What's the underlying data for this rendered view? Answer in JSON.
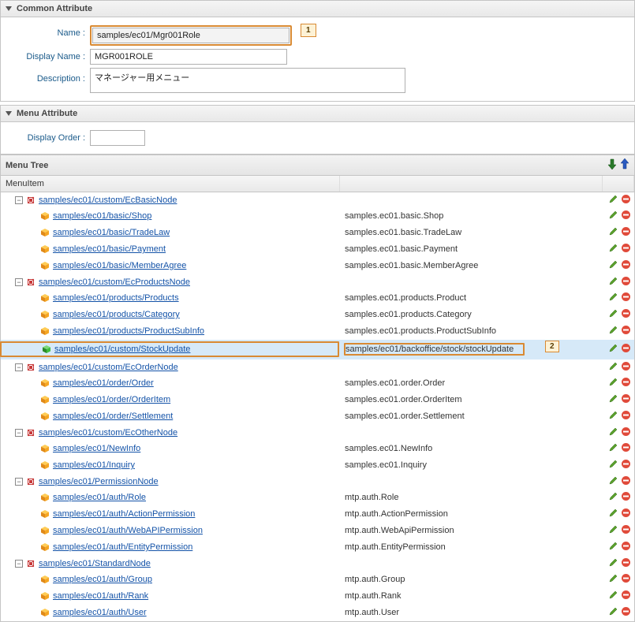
{
  "commonAttr": {
    "header": "Common Attribute",
    "name_label": "Name :",
    "name_value": "samples/ec01/Mgr001Role",
    "displayname_label": "Display Name :",
    "displayname_value": "MGR001ROLE",
    "description_label": "Description :",
    "description_value": "マネージャー用メニュー",
    "callout1": "1"
  },
  "menuAttr": {
    "header": "Menu Attribute",
    "displayorder_label": "Display Order :",
    "displayorder_value": ""
  },
  "menuTree": {
    "header": "Menu Tree",
    "col_menuitem": "MenuItem",
    "nodes": [
      {
        "type": "folder",
        "level": 0,
        "label": "samples/ec01/custom/EcBasicNode"
      },
      {
        "type": "item",
        "level": 1,
        "label": "samples/ec01/basic/Shop",
        "path": "samples.ec01.basic.Shop"
      },
      {
        "type": "item",
        "level": 1,
        "label": "samples/ec01/basic/TradeLaw",
        "path": "samples.ec01.basic.TradeLaw"
      },
      {
        "type": "item",
        "level": 1,
        "label": "samples/ec01/basic/Payment",
        "path": "samples.ec01.basic.Payment"
      },
      {
        "type": "item",
        "level": 1,
        "label": "samples/ec01/basic/MemberAgree",
        "path": "samples.ec01.basic.MemberAgree"
      },
      {
        "type": "folder",
        "level": 0,
        "label": "samples/ec01/custom/EcProductsNode"
      },
      {
        "type": "item",
        "level": 1,
        "label": "samples/ec01/products/Products",
        "path": "samples.ec01.products.Product"
      },
      {
        "type": "item",
        "level": 1,
        "label": "samples/ec01/products/Category",
        "path": "samples.ec01.products.Category"
      },
      {
        "type": "item",
        "level": 1,
        "label": "samples/ec01/products/ProductSubInfo",
        "path": "samples.ec01.products.ProductSubInfo"
      },
      {
        "type": "selected",
        "level": 1,
        "label": "samples/ec01/custom/StockUpdate",
        "path": "samples/ec01/backoffice/stock/stockUpdate",
        "callout": "2"
      },
      {
        "type": "folder",
        "level": 0,
        "label": "samples/ec01/custom/EcOrderNode"
      },
      {
        "type": "item",
        "level": 1,
        "label": "samples/ec01/order/Order",
        "path": "samples.ec01.order.Order"
      },
      {
        "type": "item",
        "level": 1,
        "label": "samples/ec01/order/OrderItem",
        "path": "samples.ec01.order.OrderItem"
      },
      {
        "type": "item",
        "level": 1,
        "label": "samples/ec01/order/Settlement",
        "path": "samples.ec01.order.Settlement"
      },
      {
        "type": "folder",
        "level": 0,
        "label": "samples/ec01/custom/EcOtherNode"
      },
      {
        "type": "item",
        "level": 1,
        "label": "samples/ec01/NewInfo",
        "path": "samples.ec01.NewInfo"
      },
      {
        "type": "item",
        "level": 1,
        "label": "samples/ec01/Inquiry",
        "path": "samples.ec01.Inquiry"
      },
      {
        "type": "folder",
        "level": 0,
        "label": "samples/ec01/PermissionNode"
      },
      {
        "type": "item",
        "level": 1,
        "label": "samples/ec01/auth/Role",
        "path": "mtp.auth.Role"
      },
      {
        "type": "item",
        "level": 1,
        "label": "samples/ec01/auth/ActionPermission",
        "path": "mtp.auth.ActionPermission"
      },
      {
        "type": "item",
        "level": 1,
        "label": "samples/ec01/auth/WebAPIPermission",
        "path": "mtp.auth.WebApiPermission"
      },
      {
        "type": "item",
        "level": 1,
        "label": "samples/ec01/auth/EntityPermission",
        "path": "mtp.auth.EntityPermission"
      },
      {
        "type": "folder",
        "level": 0,
        "label": "samples/ec01/StandardNode"
      },
      {
        "type": "item",
        "level": 1,
        "label": "samples/ec01/auth/Group",
        "path": "mtp.auth.Group"
      },
      {
        "type": "item",
        "level": 1,
        "label": "samples/ec01/auth/Rank",
        "path": "mtp.auth.Rank"
      },
      {
        "type": "item",
        "level": 1,
        "label": "samples/ec01/auth/User",
        "path": "mtp.auth.User"
      }
    ]
  }
}
